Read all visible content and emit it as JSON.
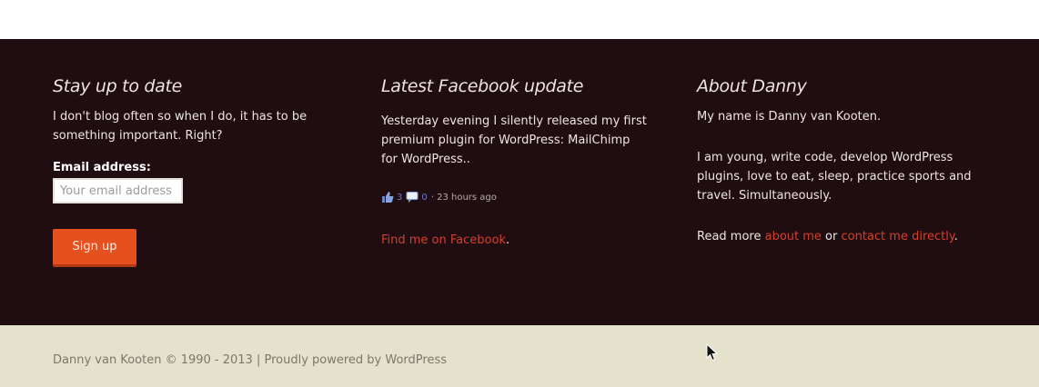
{
  "widgets": {
    "newsletter": {
      "title": "Stay up to date",
      "description": "I don't blog often so when I do, it has to be something important. Right?",
      "email_label": "Email address:",
      "email_placeholder": "Your email address",
      "email_value": "",
      "signup_label": "Sign up"
    },
    "facebook": {
      "title": "Latest Facebook update",
      "post": "Yesterday evening I silently released my first premium plugin for WordPress: MailChimp for WordPress..",
      "likes": "3",
      "comments": "0",
      "time": "· 23 hours ago",
      "link_text": "Find me on Facebook",
      "link_suffix": "."
    },
    "about": {
      "title": "About Danny",
      "intro": "My name is Danny van Kooten.",
      "body": "I am young, write code, develop WordPress plugins, love to eat, sleep, practice sports and travel. Simultaneously.",
      "read_more_prefix": "Read more ",
      "about_link": "about me",
      "or_text": " or ",
      "contact_link": "contact me directly",
      "suffix": "."
    }
  },
  "footer": {
    "credits": "Danny van Kooten © 1990 - 2013 | Proudly powered by WordPress"
  },
  "colors": {
    "widget_background": "#200d11",
    "footer_background": "#e4e2cc",
    "accent": "#d2402c",
    "button": "#e5501f"
  },
  "icons": [
    "like-icon",
    "comment-icon",
    "mouse-cursor-icon"
  ]
}
